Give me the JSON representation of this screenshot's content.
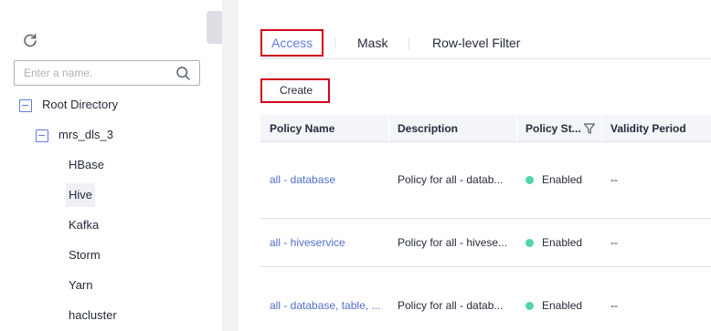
{
  "sidebar": {
    "search": {
      "placeholder": "Enter a name.",
      "value": ""
    },
    "tree": {
      "root": {
        "label": "Root Directory",
        "expanded": true
      },
      "cluster": {
        "label": "mrs_dls_3",
        "expanded": true
      },
      "services": [
        {
          "label": "HBase",
          "selected": false
        },
        {
          "label": "Hive",
          "selected": true
        },
        {
          "label": "Kafka",
          "selected": false
        },
        {
          "label": "Storm",
          "selected": false
        },
        {
          "label": "Yarn",
          "selected": false
        },
        {
          "label": "hacluster",
          "selected": false
        }
      ]
    }
  },
  "tabs": [
    {
      "label": "Access",
      "active": true
    },
    {
      "label": "Mask",
      "active": false
    },
    {
      "label": "Row-level Filter",
      "active": false
    }
  ],
  "toolbar": {
    "create_label": "Create"
  },
  "table": {
    "columns": [
      "Policy Name",
      "Description",
      "Policy St...",
      "Validity Period"
    ],
    "rows": [
      {
        "name": "all - database",
        "description": "Policy for all - datab...",
        "status": "Enabled",
        "validity": "--"
      },
      {
        "name": "all - hiveservice",
        "description": "Policy for all - hivese...",
        "status": "Enabled",
        "validity": "--"
      },
      {
        "name": "all - database, table, ...",
        "description": "Policy for all - datab...",
        "status": "Enabled",
        "validity": "--"
      }
    ]
  },
  "colors": {
    "accent": "#5e7ce0",
    "link": "#526ecc",
    "status_enabled": "#50d4ab",
    "highlight_box": "#d0021b",
    "selected_bg": "#eef0f5"
  },
  "icons": [
    "refresh-icon",
    "search-icon",
    "collapse-icon",
    "filter-icon"
  ]
}
